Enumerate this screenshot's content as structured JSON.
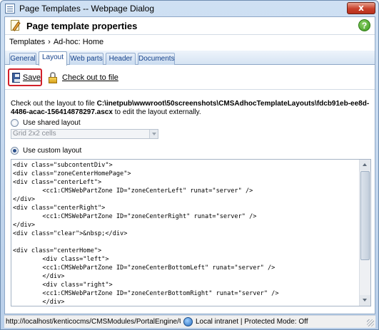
{
  "window": {
    "title": "Page Templates -- Webpage Dialog",
    "close_label": "x"
  },
  "header": {
    "title": "Page template properties",
    "help_label": "?"
  },
  "breadcrumb": {
    "root": "Templates",
    "separator": "›",
    "current": "Ad-hoc: Home"
  },
  "tabs": [
    {
      "label": "General"
    },
    {
      "label": "Layout"
    },
    {
      "label": "Web parts"
    },
    {
      "label": "Header"
    },
    {
      "label": "Documents"
    }
  ],
  "toolbar": {
    "save_label": "Save",
    "checkout_label": "Check out to file"
  },
  "info": {
    "prefix": "Check out the layout to file ",
    "path": "C:\\inetpub\\wwwroot\\50screenshots\\CMSAdhocTemplateLayouts\\fdcb91eb-ee8d-4486-acac-156414878297.ascx",
    "suffix": " to edit the layout externally."
  },
  "layout_options": {
    "shared_label": "Use shared layout",
    "shared_value": "Grid 2x2 cells",
    "custom_label": "Use custom layout",
    "selected": "custom"
  },
  "code": "<div class=\"subcontentDiv\">\n<div class=\"zoneCenterHomePage\">\n<div class=\"centerLeft\">\n        <cc1:CMSWebPartZone ID=\"zoneCenterLeft\" runat=\"server\" />\n</div>\n<div class=\"centerRight\">\n        <cc1:CMSWebPartZone ID=\"zoneCenterRight\" runat=\"server\" />\n</div>\n<div class=\"clear\">&nbsp;</div>\n\n<div class=\"centerHome\">\n        <div class=\"left\">\n        <cc1:CMSWebPartZone ID=\"zoneCenterBottomLeft\" runat=\"server\" />\n        </div>\n        <div class=\"right\">\n        <cc1:CMSWebPartZone ID=\"zoneCenterBottomRight\" runat=\"server\" />\n        </div>\n        <div class=\"clear\">&nbsp;</div>\n</div>",
  "status": {
    "url": "http://localhost/kenticocms/CMSModules/PortalEngine/UI/Pag",
    "zone": "Local intranet | Protected Mode: Off"
  },
  "colors": {
    "accent": "#15428b",
    "save_highlight": "#d2202a",
    "help": "#3c9a1e"
  }
}
